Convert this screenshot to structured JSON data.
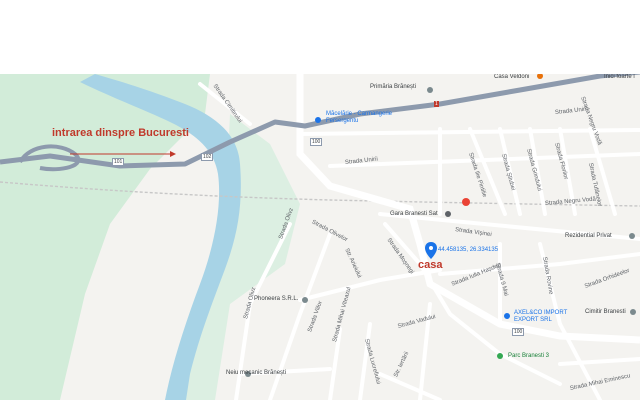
{
  "annotations": {
    "entry": "intrarea dinspre Bucuresti",
    "home": "casa",
    "coords": "44.458135, 26.334135"
  },
  "routes": {
    "r100": "100",
    "r101": "101",
    "r102": "102",
    "r1": "1"
  },
  "streets": {
    "cimitirului": "Strada Cimitirului",
    "negru_voda_upper": "Strada Negru Vodă",
    "unirii_upper": "Strada Unirii",
    "unirii_lower": "Strada Unirii",
    "negru_voda_mid": "Strada Negru Vodă",
    "stiubei": "Strada Știubei",
    "grindului": "Strada Grindului",
    "florilor": "Strada Florilor",
    "tufanelor": "Strada Tufănelor",
    "ilie_pintilie": "Strada Ilie Pintilie",
    "visinei": "Strada Vișinei",
    "olivelor": "Strada Olivelor",
    "olivz": "Strada Olivz",
    "arieiului": "Str. Arieiului",
    "mosnegi": "Strada Moșnegi",
    "iulia_hasdeu": "Strada Iulia Hașdeu",
    "mai9": "Strada 9 Mai",
    "rovine": "Strada Rovine",
    "orhideelor": "Strada Orhideelor",
    "olivz2": "Strada Olivz",
    "viilor": "Strada Viilor",
    "vadului": "Strada Vadului",
    "mihai_viteazul": "Strada Mihai Viteazul",
    "lucrefiului": "Strada Lucrefiului",
    "iertarii": "Str. Iertării",
    "mihai_eminescu": "Strada Mihai Eminescu"
  },
  "places": {
    "casa_veldoni": "Casa Veldoni",
    "primaria": "Primăria Brănești",
    "macelarie": "Măcelărie - Carmangerie Fersergentu",
    "gara": "Gara Branesti Sat",
    "rezidential": "Rezidential Privat",
    "phoneera": "Phoneera S.R.L.",
    "axel": "AXEL&CO IMPORT EXPORT SRL",
    "cimitir": "Cimitir Branesti",
    "parc": "Parc Branesti 3",
    "neiu": "Neiu mecanic Brănești",
    "corner_top": "Inici foarte l"
  },
  "colors": {
    "water": "#a7d3e6",
    "forest": "#d2ecd9",
    "major_road": "#8d9aad",
    "annotation_red": "#c0392b",
    "pin_blue": "#1a73e8"
  }
}
